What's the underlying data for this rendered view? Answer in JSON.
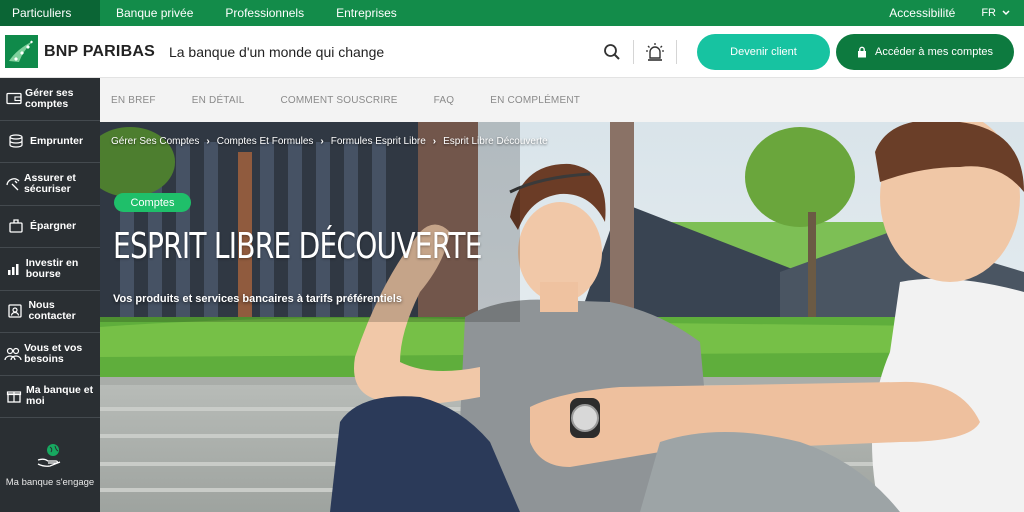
{
  "topbar": {
    "segments": [
      "Particuliers",
      "Banque privée",
      "Professionnels",
      "Entreprises"
    ],
    "accessibility": "Accessibilité",
    "language": "FR"
  },
  "header": {
    "brand": "BNP PARIBAS",
    "tagline": "La banque d'un monde qui change",
    "become_client": "Devenir client",
    "access_accounts": "Accéder à mes comptes"
  },
  "sidebar": {
    "items": [
      {
        "label": "Gérer ses comptes",
        "icon": "wallet-icon"
      },
      {
        "label": "Emprunter",
        "icon": "coins-icon"
      },
      {
        "label": "Assurer et sécuriser",
        "icon": "umbrella-icon"
      },
      {
        "label": "Épargner",
        "icon": "piggy-icon"
      },
      {
        "label": "Investir en bourse",
        "icon": "chart-icon"
      },
      {
        "label": "Nous contacter",
        "icon": "contact-icon"
      },
      {
        "label": "Vous et vos besoins",
        "icon": "people-icon"
      },
      {
        "label": "Ma banque et moi",
        "icon": "gift-icon"
      }
    ],
    "engage": "Ma banque s'engage"
  },
  "subnav": {
    "tabs": [
      "EN BREF",
      "EN DÉTAIL",
      "COMMENT SOUSCRIRE",
      "FAQ",
      "EN COMPLÉMENT"
    ]
  },
  "hero": {
    "breadcrumb": [
      "Gérer Ses Comptes",
      "Comptes Et Formules",
      "Formules Esprit Libre",
      "Esprit Libre Découverte"
    ],
    "badge": "Comptes",
    "title": "ESPRIT LIBRE DÉCOUVERTE",
    "subtitle": "Vos produits et services bancaires à tarifs préférentiels"
  },
  "colors": {
    "brand_green": "#138c4a",
    "dark_green": "#0d7a3f",
    "teal": "#17c3a1",
    "sidebar_bg": "#2a2f33"
  }
}
